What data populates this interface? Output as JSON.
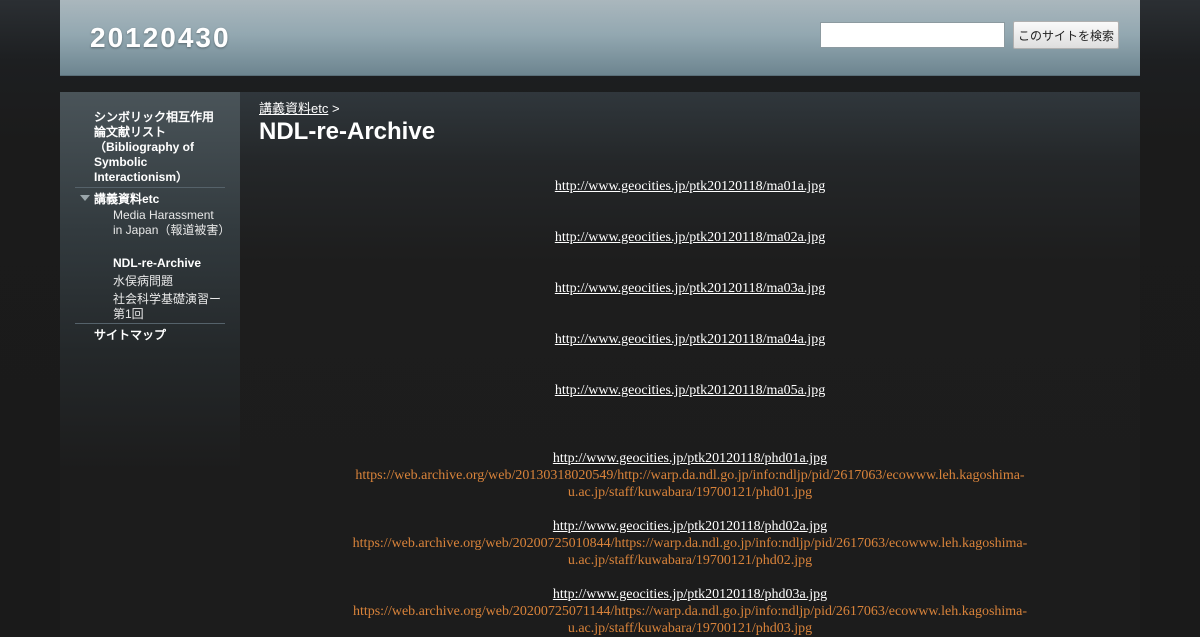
{
  "site": {
    "title": "20120430"
  },
  "search": {
    "placeholder": "",
    "button_label": "このサイトを検索"
  },
  "sidebar": {
    "item_bibliography": "シンボリック相互作用論文献リスト（Bibliography of Symbolic Interactionism）",
    "item_lecture": "講義資料etc",
    "children": [
      "Media Harassment in Japan（報道被害）",
      "NDL-re-Archive",
      "水俣病問題",
      "社会科学基礎演習ー第1回"
    ],
    "item_sitemap": "サイトマップ"
  },
  "breadcrumb": {
    "parent": "講義資料etc",
    "separator": ">"
  },
  "page": {
    "title": "NDL-re-Archive"
  },
  "links": {
    "ma": [
      "http://www.geocities.jp/ptk20120118/ma01a.jpg",
      "http://www.geocities.jp/ptk20120118/ma02a.jpg",
      "http://www.geocities.jp/ptk20120118/ma03a.jpg",
      "http://www.geocities.jp/ptk20120118/ma04a.jpg",
      "http://www.geocities.jp/ptk20120118/ma05a.jpg"
    ],
    "phd": [
      {
        "geo": "http://www.geocities.jp/ptk20120118/phd01a.jpg",
        "archive": "https://web.archive.org/web/20130318020549/http://warp.da.ndl.go.jp/info:ndljp/pid/2617063/ecowww.leh.kagoshima-u.ac.jp/staff/kuwabara/19700121/phd01.jpg"
      },
      {
        "geo": "http://www.geocities.jp/ptk20120118/phd02a.jpg",
        "archive": "https://web.archive.org/web/20200725010844/https://warp.da.ndl.go.jp/info:ndljp/pid/2617063/ecowww.leh.kagoshima-u.ac.jp/staff/kuwabara/19700121/phd02.jpg"
      },
      {
        "geo": "http://www.geocities.jp/ptk20120118/phd03a.jpg",
        "archive": "https://web.archive.org/web/20200725071144/https://warp.da.ndl.go.jp/info:ndljp/pid/2617063/ecowww.leh.kagoshima-u.ac.jp/staff/kuwabara/19700121/phd03.jpg"
      }
    ]
  },
  "colors": {
    "header": "#93a8b1",
    "background": "#1c1c1c",
    "archive_link": "#d9833a",
    "link": "#ffffff"
  }
}
